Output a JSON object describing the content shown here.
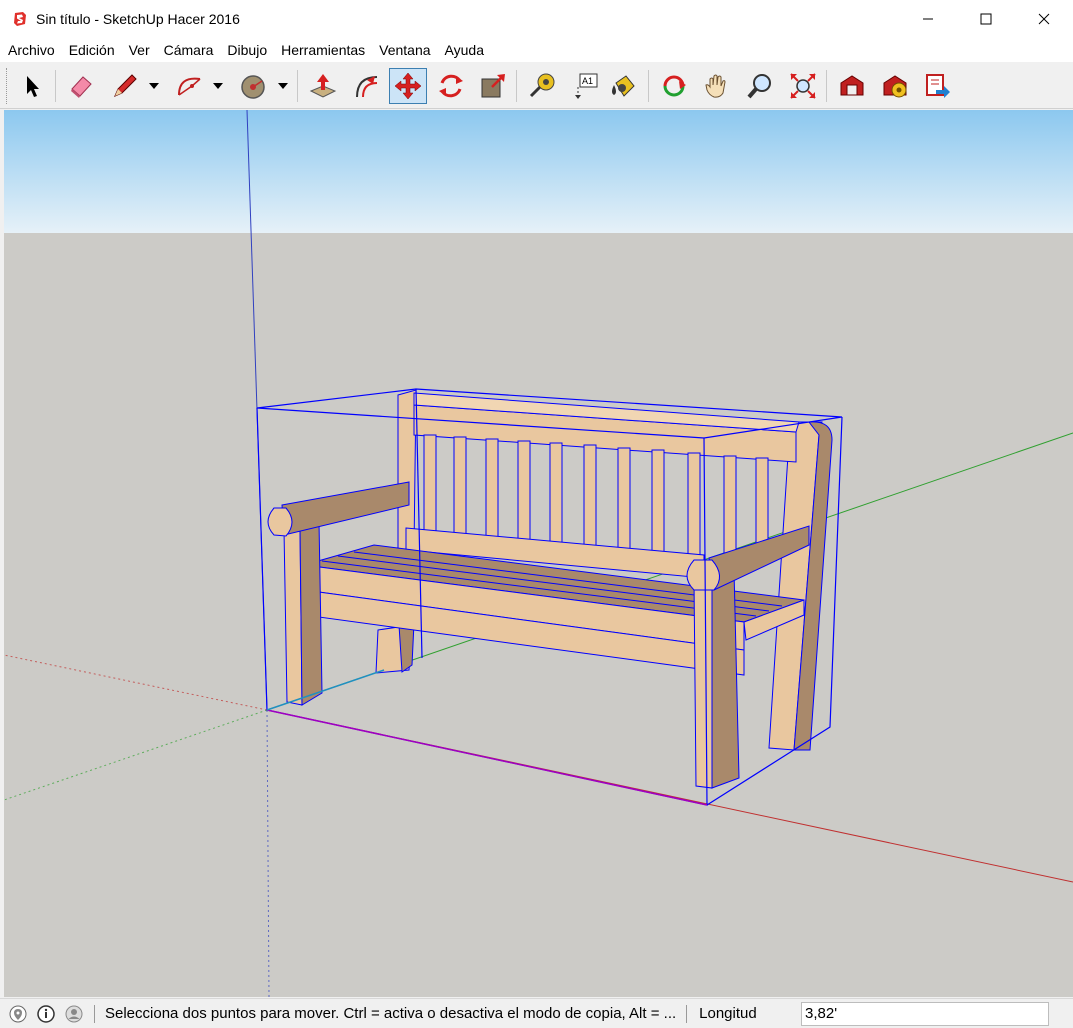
{
  "window": {
    "title": "Sin título - SketchUp Hacer 2016"
  },
  "menu": [
    "Archivo",
    "Edición",
    "Ver",
    "Cámara",
    "Dibujo",
    "Herramientas",
    "Ventana",
    "Ayuda"
  ],
  "toolbar": {
    "tools": [
      {
        "name": "select-tool",
        "icon": "arrow-cursor-icon"
      },
      {
        "name": "eraser-tool",
        "icon": "eraser-icon"
      },
      {
        "name": "line-tool",
        "icon": "pencil-icon"
      },
      {
        "name": "arc-tool",
        "icon": "arc-icon"
      },
      {
        "name": "shapes-tool",
        "icon": "circle-shape-icon"
      },
      {
        "name": "push-pull-tool",
        "icon": "push-pull-icon"
      },
      {
        "name": "offset-tool",
        "icon": "offset-icon"
      },
      {
        "name": "move-tool",
        "icon": "move-icon",
        "active": true
      },
      {
        "name": "rotate-tool",
        "icon": "rotate-icon"
      },
      {
        "name": "scale-tool",
        "icon": "scale-icon"
      },
      {
        "name": "tape-measure-tool",
        "icon": "tape-measure-icon"
      },
      {
        "name": "text-tool",
        "icon": "text-label-icon"
      },
      {
        "name": "paint-bucket-tool",
        "icon": "paint-bucket-icon"
      },
      {
        "name": "orbit-tool",
        "icon": "orbit-icon"
      },
      {
        "name": "pan-tool",
        "icon": "hand-icon"
      },
      {
        "name": "zoom-tool",
        "icon": "magnifier-icon"
      },
      {
        "name": "zoom-extents-tool",
        "icon": "zoom-extents-icon"
      },
      {
        "name": "3d-warehouse-tool",
        "icon": "warehouse-icon"
      },
      {
        "name": "extension-warehouse-tool",
        "icon": "extension-warehouse-icon"
      },
      {
        "name": "layout-send-tool",
        "icon": "send-to-layout-icon"
      }
    ],
    "text_tool_label": "A1"
  },
  "colors": {
    "sky_top": "#8cc8ef",
    "sky_bottom": "#e6f1f8",
    "ground": "#cccbc7",
    "wood_light": "#e9c79f",
    "wood_dark": "#a9896b",
    "selection": "#0000ff",
    "active_tool_bg": "#cce4f7"
  },
  "status": {
    "message": "Selecciona dos puntos para mover. Ctrl = activa o desactiva el modo de copia, Alt = ...",
    "measurement_label": "Longitud",
    "measurement_value": "3,82'"
  }
}
